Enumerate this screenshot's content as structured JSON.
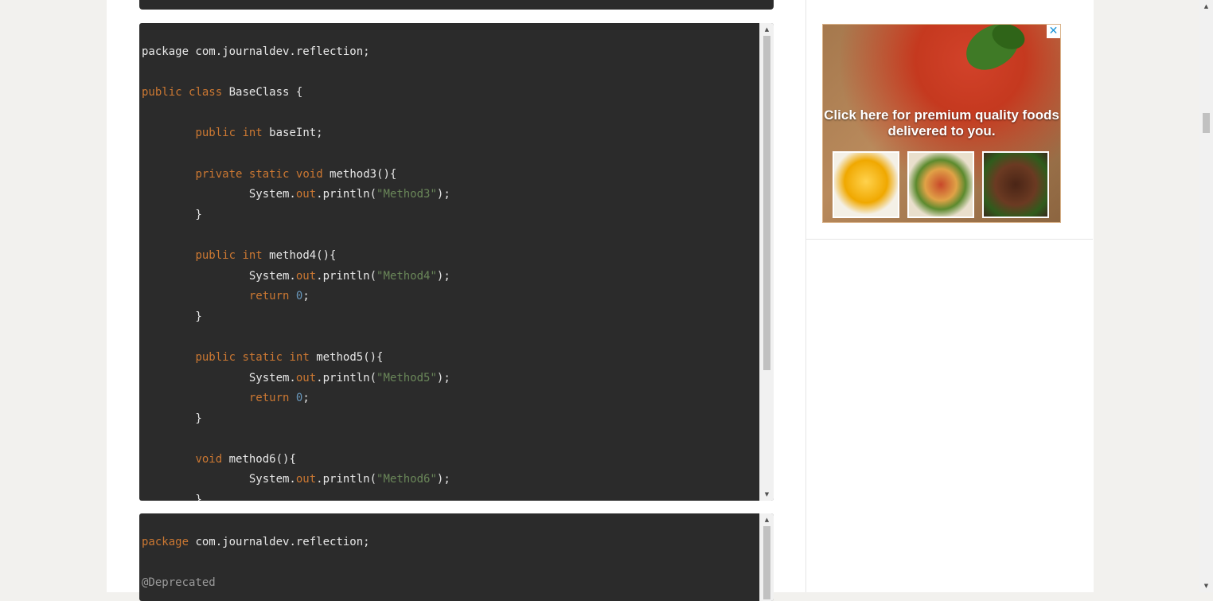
{
  "code_block_1": {
    "lines": [
      [
        {
          "t": "package com.journaldev.reflection;",
          "c": ""
        }
      ],
      [],
      [
        {
          "t": "public",
          "c": "kw"
        },
        {
          "t": " ",
          "c": ""
        },
        {
          "t": "class",
          "c": "kw"
        },
        {
          "t": " BaseClass {",
          "c": ""
        }
      ],
      [],
      [
        {
          "t": "        ",
          "c": ""
        },
        {
          "t": "public",
          "c": "kw"
        },
        {
          "t": " ",
          "c": ""
        },
        {
          "t": "int",
          "c": "kw"
        },
        {
          "t": " baseInt;",
          "c": ""
        }
      ],
      [],
      [
        {
          "t": "        ",
          "c": ""
        },
        {
          "t": "private",
          "c": "kw"
        },
        {
          "t": " ",
          "c": ""
        },
        {
          "t": "static",
          "c": "kw"
        },
        {
          "t": " ",
          "c": ""
        },
        {
          "t": "void",
          "c": "kw"
        },
        {
          "t": " method3(){",
          "c": ""
        }
      ],
      [
        {
          "t": "                System.",
          "c": ""
        },
        {
          "t": "out",
          "c": "fld"
        },
        {
          "t": ".println(",
          "c": ""
        },
        {
          "t": "\"Method3\"",
          "c": "str"
        },
        {
          "t": ");",
          "c": ""
        }
      ],
      [
        {
          "t": "        }",
          "c": ""
        }
      ],
      [],
      [
        {
          "t": "        ",
          "c": ""
        },
        {
          "t": "public",
          "c": "kw"
        },
        {
          "t": " ",
          "c": ""
        },
        {
          "t": "int",
          "c": "kw"
        },
        {
          "t": " method4(){",
          "c": ""
        }
      ],
      [
        {
          "t": "                System.",
          "c": ""
        },
        {
          "t": "out",
          "c": "fld"
        },
        {
          "t": ".println(",
          "c": ""
        },
        {
          "t": "\"Method4\"",
          "c": "str"
        },
        {
          "t": ");",
          "c": ""
        }
      ],
      [
        {
          "t": "                ",
          "c": ""
        },
        {
          "t": "return",
          "c": "kw"
        },
        {
          "t": " ",
          "c": ""
        },
        {
          "t": "0",
          "c": "num"
        },
        {
          "t": ";",
          "c": ""
        }
      ],
      [
        {
          "t": "        }",
          "c": ""
        }
      ],
      [],
      [
        {
          "t": "        ",
          "c": ""
        },
        {
          "t": "public",
          "c": "kw"
        },
        {
          "t": " ",
          "c": ""
        },
        {
          "t": "static",
          "c": "kw"
        },
        {
          "t": " ",
          "c": ""
        },
        {
          "t": "int",
          "c": "kw"
        },
        {
          "t": " method5(){",
          "c": ""
        }
      ],
      [
        {
          "t": "                System.",
          "c": ""
        },
        {
          "t": "out",
          "c": "fld"
        },
        {
          "t": ".println(",
          "c": ""
        },
        {
          "t": "\"Method5\"",
          "c": "str"
        },
        {
          "t": ");",
          "c": ""
        }
      ],
      [
        {
          "t": "                ",
          "c": ""
        },
        {
          "t": "return",
          "c": "kw"
        },
        {
          "t": " ",
          "c": ""
        },
        {
          "t": "0",
          "c": "num"
        },
        {
          "t": ";",
          "c": ""
        }
      ],
      [
        {
          "t": "        }",
          "c": ""
        }
      ],
      [],
      [
        {
          "t": "        ",
          "c": ""
        },
        {
          "t": "void",
          "c": "kw"
        },
        {
          "t": " method6(){",
          "c": ""
        }
      ],
      [
        {
          "t": "                System.",
          "c": ""
        },
        {
          "t": "out",
          "c": "fld"
        },
        {
          "t": ".println(",
          "c": ""
        },
        {
          "t": "\"Method6\"",
          "c": "str"
        },
        {
          "t": ");",
          "c": ""
        }
      ],
      [
        {
          "t": "        }",
          "c": ""
        }
      ]
    ]
  },
  "code_block_2": {
    "lines": [
      [
        {
          "t": "package",
          "c": "kw"
        },
        {
          "t": " com.journaldev.reflection;",
          "c": ""
        }
      ],
      [],
      [
        {
          "t": "@Deprecated",
          "c": "ann"
        }
      ]
    ]
  },
  "ad": {
    "headline": "Click here for premium quality foods delivered to you.",
    "close_symbol": "✕"
  },
  "scroll": {
    "up_arrow": "▲",
    "down_arrow": "▼"
  },
  "colors": {
    "code_bg": "#2b2b2b",
    "keyword": "#cc7832",
    "string": "#6a8759",
    "number": "#6897bb"
  }
}
